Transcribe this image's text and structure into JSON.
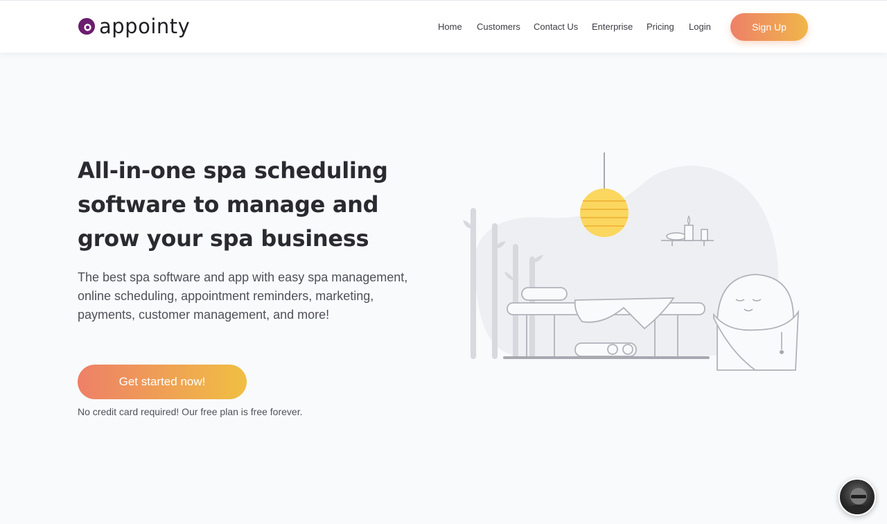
{
  "brand": {
    "name": "appointy",
    "color": "#6b1e6e"
  },
  "nav": {
    "items": [
      {
        "label": "Home"
      },
      {
        "label": "Customers"
      },
      {
        "label": "Contact Us"
      },
      {
        "label": "Enterprise"
      },
      {
        "label": "Pricing"
      },
      {
        "label": "Login"
      }
    ],
    "signup_label": "Sign Up"
  },
  "hero": {
    "title": "All-in-one spa scheduling software to manage and grow your spa business",
    "subtitle": "The best spa software and app with easy spa management, online scheduling, appointment reminders, marketing, payments, customer management, and more!",
    "cta_label": "Get started now!",
    "note": "No credit card required! Our free plan is free forever."
  },
  "colors": {
    "accent_start": "#ee8068",
    "accent_end": "#f0bf42",
    "background": "#f9fafc"
  },
  "icons": {
    "logo": "appointy-logo-icon",
    "chat": "chat-support-avatar"
  }
}
